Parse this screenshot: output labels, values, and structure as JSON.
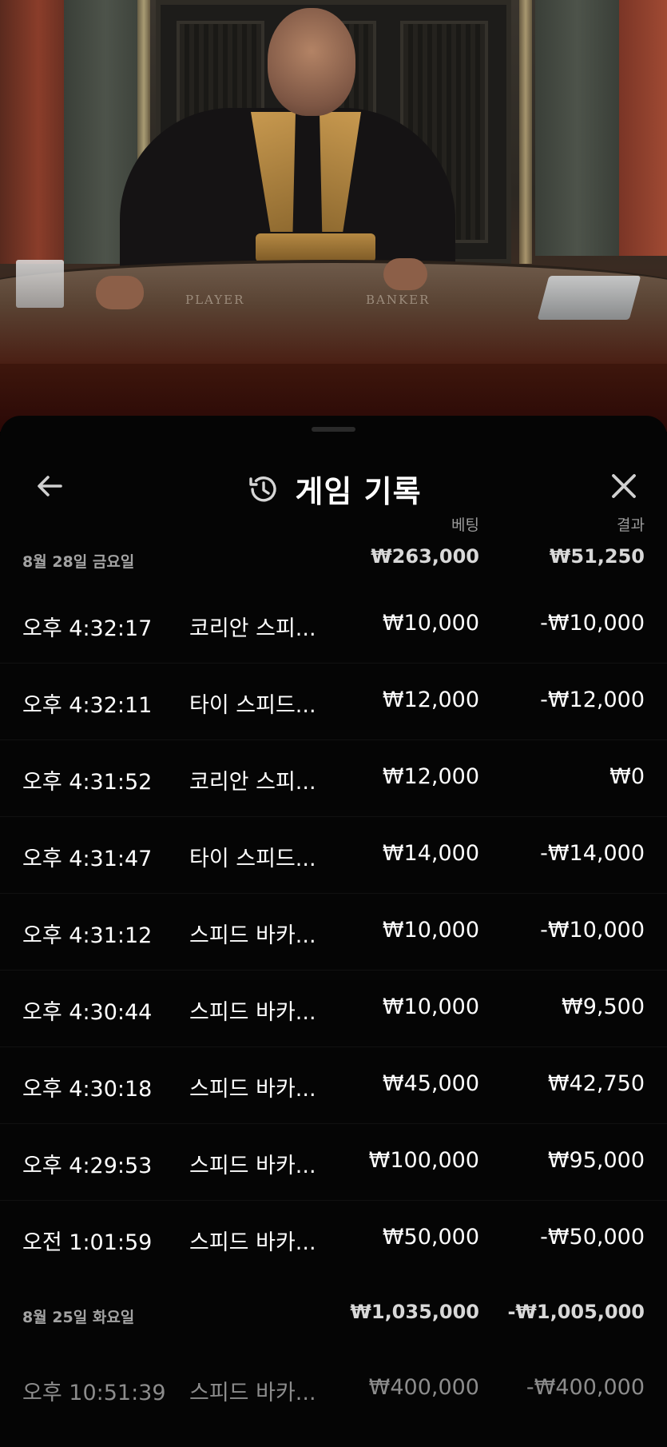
{
  "video": {
    "table_labels": [
      "PLAYER",
      "BANKER"
    ]
  },
  "sheet": {
    "title": "게임 기록",
    "icons": {
      "back": "arrow-left-icon",
      "history": "history-clock-icon",
      "close": "close-icon"
    },
    "columns": {
      "bet": "베팅",
      "result": "결과"
    },
    "groups": [
      {
        "date": "8월 28일 금요일",
        "total_bet": "₩263,000",
        "total_result": "₩51,250",
        "rows": [
          {
            "time": "오후 4:32:17",
            "game": "코리안 스피...",
            "bet": "₩10,000",
            "result": "-₩10,000"
          },
          {
            "time": "오후 4:32:11",
            "game": "타이 스피드...",
            "bet": "₩12,000",
            "result": "-₩12,000"
          },
          {
            "time": "오후 4:31:52",
            "game": "코리안 스피...",
            "bet": "₩12,000",
            "result": "₩0"
          },
          {
            "time": "오후 4:31:47",
            "game": "타이 스피드...",
            "bet": "₩14,000",
            "result": "-₩14,000"
          },
          {
            "time": "오후 4:31:12",
            "game": "스피드 바카...",
            "bet": "₩10,000",
            "result": "-₩10,000"
          },
          {
            "time": "오후 4:30:44",
            "game": "스피드 바카...",
            "bet": "₩10,000",
            "result": "₩9,500"
          },
          {
            "time": "오후 4:30:18",
            "game": "스피드 바카...",
            "bet": "₩45,000",
            "result": "₩42,750"
          },
          {
            "time": "오후 4:29:53",
            "game": "스피드 바카...",
            "bet": "₩100,000",
            "result": "₩95,000"
          },
          {
            "time": "오전 1:01:59",
            "game": "스피드 바카...",
            "bet": "₩50,000",
            "result": "-₩50,000"
          }
        ]
      },
      {
        "date": "8월 25일 화요일",
        "total_bet": "₩1,035,000",
        "total_result": "-₩1,005,000",
        "rows": [
          {
            "time": "오후 10:51:39",
            "game": "스피드 바카...",
            "bet": "₩400,000",
            "result": "-₩400,000"
          }
        ]
      }
    ]
  }
}
